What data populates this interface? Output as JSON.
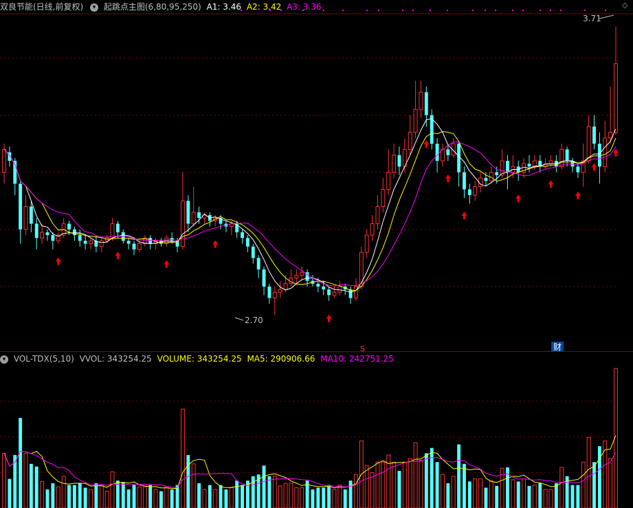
{
  "price_header": {
    "stock_name": "双良节能(日线,前复权)",
    "indicator": "起跳点主图(6,80,95,250)",
    "a1": "A1: 3.46",
    "a2": "A2: 3.42",
    "a3": "A3: 3.36"
  },
  "price_annotations": {
    "high_label": "3.71",
    "low_label": "2.70",
    "marker_s": "S",
    "marker_cai": "财"
  },
  "volume_header": {
    "indicator": "VOL-TDX(5,10)",
    "vvol": "VVOL: 343254.25",
    "volume": "VOLUME: 343254.25",
    "ma5": "MA5: 290906.66",
    "ma10": "MA10: 242751.25"
  },
  "colors": {
    "up": "#ff3232",
    "down": "#54ffff",
    "grid": "#800000",
    "ma5": "#ffff00",
    "ma10": "#ff00ff",
    "ma_white": "#ffffff",
    "arrow": "#ff0000",
    "a1": "#ffffff",
    "a2": "#ffff00",
    "a3": "#ff00ff"
  },
  "chart_data": {
    "type": "candlestick",
    "ylim": [
      2.6,
      3.75
    ],
    "candles": [
      [
        3.2,
        3.28,
        3.3,
        3.16
      ],
      [
        3.27,
        3.24,
        3.29,
        3.22
      ],
      [
        3.24,
        3.16,
        3.25,
        3.12
      ],
      [
        3.16,
        3.0,
        3.17,
        2.95
      ],
      [
        3.0,
        3.08,
        3.12,
        2.98
      ],
      [
        3.08,
        3.02,
        3.1,
        2.99
      ],
      [
        3.02,
        2.97,
        3.04,
        2.93
      ],
      [
        2.97,
        2.99,
        3.02,
        2.95
      ],
      [
        2.99,
        2.98,
        3.0,
        2.96
      ],
      [
        2.98,
        2.96,
        2.99,
        2.93
      ],
      [
        2.96,
        2.98,
        2.99,
        2.95
      ],
      [
        2.98,
        3.02,
        3.04,
        2.97
      ],
      [
        3.02,
        3.0,
        3.03,
        2.98
      ],
      [
        3.0,
        2.98,
        3.01,
        2.96
      ],
      [
        2.98,
        2.96,
        3.0,
        2.94
      ],
      [
        2.96,
        2.95,
        2.98,
        2.93
      ],
      [
        2.95,
        2.96,
        2.97,
        2.93
      ],
      [
        2.96,
        2.94,
        2.98,
        2.92
      ],
      [
        2.94,
        2.96,
        2.97,
        2.92
      ],
      [
        2.96,
        2.97,
        2.98,
        2.95
      ],
      [
        2.97,
        3.02,
        3.04,
        2.96
      ],
      [
        3.02,
        2.99,
        3.03,
        2.97
      ],
      [
        2.99,
        2.96,
        3.0,
        2.95
      ],
      [
        2.96,
        2.95,
        2.97,
        2.93
      ],
      [
        2.95,
        2.93,
        2.96,
        2.91
      ],
      [
        2.93,
        2.95,
        2.96,
        2.92
      ],
      [
        2.95,
        2.97,
        2.98,
        2.94
      ],
      [
        2.97,
        2.95,
        2.98,
        2.93
      ],
      [
        2.95,
        2.96,
        2.97,
        2.93
      ],
      [
        2.96,
        2.95,
        2.97,
        2.94
      ],
      [
        2.95,
        2.97,
        2.98,
        2.94
      ],
      [
        2.97,
        2.96,
        2.99,
        2.95
      ],
      [
        2.96,
        2.94,
        2.97,
        2.92
      ],
      [
        2.94,
        3.1,
        3.2,
        2.93
      ],
      [
        3.1,
        3.02,
        3.12,
        2.99
      ],
      [
        3.02,
        3.06,
        3.15,
        3.01
      ],
      [
        3.06,
        3.04,
        3.08,
        3.02
      ],
      [
        3.04,
        3.05,
        3.06,
        3.02
      ],
      [
        3.05,
        3.03,
        3.06,
        3.01
      ],
      [
        3.03,
        3.04,
        3.05,
        3.01
      ],
      [
        3.04,
        3.02,
        3.05,
        3.0
      ],
      [
        3.02,
        3.01,
        3.03,
        2.99
      ],
      [
        3.01,
        3.02,
        3.03,
        2.98
      ],
      [
        3.02,
        2.99,
        3.03,
        2.97
      ],
      [
        2.99,
        2.97,
        3.0,
        2.95
      ],
      [
        2.97,
        2.94,
        2.98,
        2.92
      ],
      [
        2.94,
        2.9,
        2.95,
        2.88
      ],
      [
        2.9,
        2.86,
        2.91,
        2.83
      ],
      [
        2.86,
        2.8,
        2.87,
        2.77
      ],
      [
        2.8,
        2.76,
        2.81,
        2.74
      ],
      [
        2.76,
        2.78,
        2.8,
        2.7
      ],
      [
        2.78,
        2.79,
        2.82,
        2.76
      ],
      [
        2.79,
        2.81,
        2.84,
        2.78
      ],
      [
        2.81,
        2.83,
        2.86,
        2.8
      ],
      [
        2.83,
        2.84,
        2.86,
        2.81
      ],
      [
        2.84,
        2.85,
        2.87,
        2.82
      ],
      [
        2.85,
        2.82,
        2.86,
        2.8
      ],
      [
        2.82,
        2.81,
        2.84,
        2.8
      ],
      [
        2.81,
        2.8,
        2.83,
        2.78
      ],
      [
        2.8,
        2.79,
        2.82,
        2.77
      ],
      [
        2.79,
        2.77,
        2.8,
        2.75
      ],
      [
        2.77,
        2.78,
        2.8,
        2.76
      ],
      [
        2.78,
        2.8,
        2.82,
        2.77
      ],
      [
        2.8,
        2.79,
        2.81,
        2.77
      ],
      [
        2.79,
        2.76,
        2.8,
        2.74
      ],
      [
        2.76,
        2.8,
        2.83,
        2.75
      ],
      [
        2.8,
        2.92,
        2.94,
        2.79
      ],
      [
        2.92,
        2.98,
        3.0,
        2.9
      ],
      [
        2.98,
        3.02,
        3.05,
        2.96
      ],
      [
        3.02,
        3.08,
        3.12,
        3.0
      ],
      [
        3.08,
        3.14,
        3.18,
        3.06
      ],
      [
        3.14,
        3.2,
        3.28,
        3.12
      ],
      [
        3.2,
        3.26,
        3.3,
        3.18
      ],
      [
        3.26,
        3.22,
        3.29,
        3.19
      ],
      [
        3.22,
        3.28,
        3.32,
        3.2
      ],
      [
        3.28,
        3.34,
        3.4,
        3.26
      ],
      [
        3.34,
        3.42,
        3.52,
        3.32
      ],
      [
        3.42,
        3.48,
        3.52,
        3.39
      ],
      [
        3.48,
        3.4,
        3.5,
        3.36
      ],
      [
        3.4,
        3.3,
        3.42,
        3.28
      ],
      [
        3.3,
        3.24,
        3.32,
        3.2
      ],
      [
        3.24,
        3.28,
        3.3,
        3.22
      ],
      [
        3.28,
        3.26,
        3.3,
        3.24
      ],
      [
        3.26,
        3.3,
        3.32,
        3.25
      ],
      [
        3.3,
        3.2,
        3.31,
        3.15
      ],
      [
        3.2,
        3.14,
        3.22,
        3.11
      ],
      [
        3.14,
        3.12,
        3.16,
        3.09
      ],
      [
        3.12,
        3.15,
        3.17,
        3.1
      ],
      [
        3.15,
        3.18,
        3.2,
        3.13
      ],
      [
        3.18,
        3.17,
        3.2,
        3.15
      ],
      [
        3.17,
        3.2,
        3.22,
        3.16
      ],
      [
        3.2,
        3.19,
        3.22,
        3.16
      ],
      [
        3.19,
        3.24,
        3.28,
        3.18
      ],
      [
        3.24,
        3.2,
        3.26,
        3.14
      ],
      [
        3.2,
        3.22,
        3.26,
        3.18
      ],
      [
        3.22,
        3.2,
        3.24,
        3.17
      ],
      [
        3.2,
        3.23,
        3.25,
        3.18
      ],
      [
        3.23,
        3.22,
        3.26,
        3.2
      ],
      [
        3.22,
        3.24,
        3.26,
        3.21
      ],
      [
        3.24,
        3.22,
        3.26,
        3.2
      ],
      [
        3.22,
        3.23,
        3.25,
        3.21
      ],
      [
        3.23,
        3.24,
        3.26,
        3.22
      ],
      [
        3.24,
        3.22,
        3.26,
        3.2
      ],
      [
        3.22,
        3.28,
        3.3,
        3.21
      ],
      [
        3.28,
        3.24,
        3.29,
        3.22
      ],
      [
        3.24,
        3.22,
        3.25,
        3.2
      ],
      [
        3.22,
        3.2,
        3.23,
        3.18
      ],
      [
        3.2,
        3.24,
        3.3,
        3.15
      ],
      [
        3.24,
        3.36,
        3.4,
        3.23
      ],
      [
        3.36,
        3.3,
        3.4,
        3.28
      ],
      [
        3.3,
        3.22,
        3.34,
        3.16
      ],
      [
        3.22,
        3.32,
        3.38,
        3.2
      ],
      [
        3.32,
        3.34,
        3.5,
        3.3
      ],
      [
        3.34,
        3.58,
        3.71,
        3.33
      ]
    ]
  }
}
